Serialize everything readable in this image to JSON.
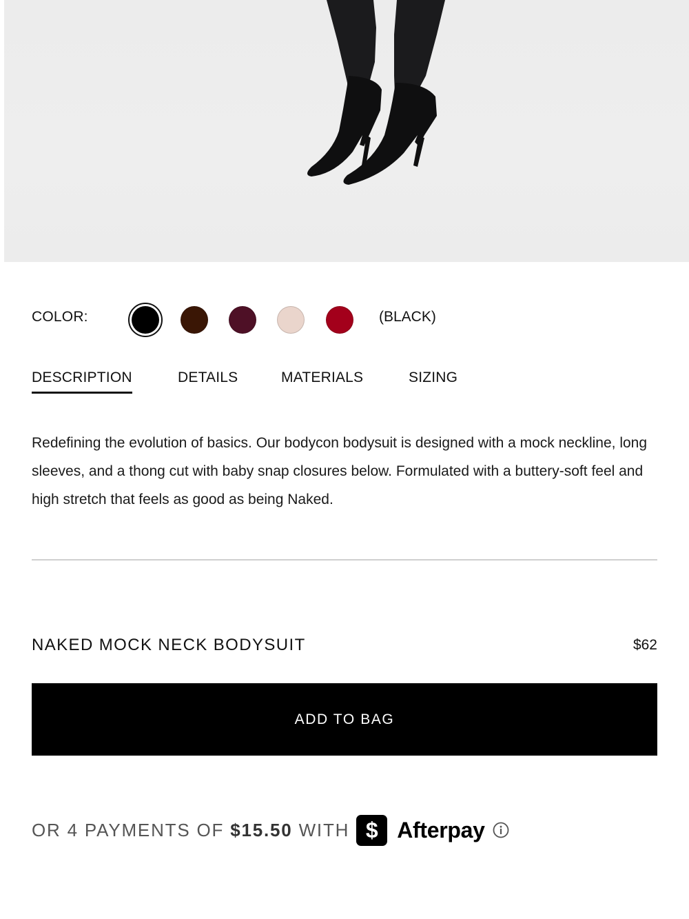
{
  "hero": {
    "alt_name": "product-image"
  },
  "color": {
    "label": "COLOR:",
    "selected_name": "(BLACK)",
    "swatches": [
      {
        "name": "black",
        "hex": "#000000",
        "selected": true
      },
      {
        "name": "brown",
        "hex": "#3a1605"
      },
      {
        "name": "plum",
        "hex": "#4e1026"
      },
      {
        "name": "nude",
        "hex": "#ead5cc"
      },
      {
        "name": "red",
        "hex": "#a3001b"
      }
    ]
  },
  "tabs": [
    {
      "label": "DESCRIPTION",
      "active": true
    },
    {
      "label": "DETAILS"
    },
    {
      "label": "MATERIALS"
    },
    {
      "label": "SIZING"
    }
  ],
  "description": "Redefining the evolution of basics. Our bodycon bodysuit is designed with a mock neckline, long sleeves, and a thong cut with baby snap closures below. Formulated with a buttery-soft feel and high stretch that feels as good as being Naked.",
  "product": {
    "name": "NAKED MOCK NECK BODYSUIT",
    "price": "$62"
  },
  "add_to_bag": "ADD TO BAG",
  "afterpay": {
    "prefix": "OR 4 PAYMENTS OF",
    "amount": "$15.50",
    "suffix": "WITH",
    "logo_glyph": "$",
    "brand": "Afterpay",
    "icon": "info-icon"
  }
}
